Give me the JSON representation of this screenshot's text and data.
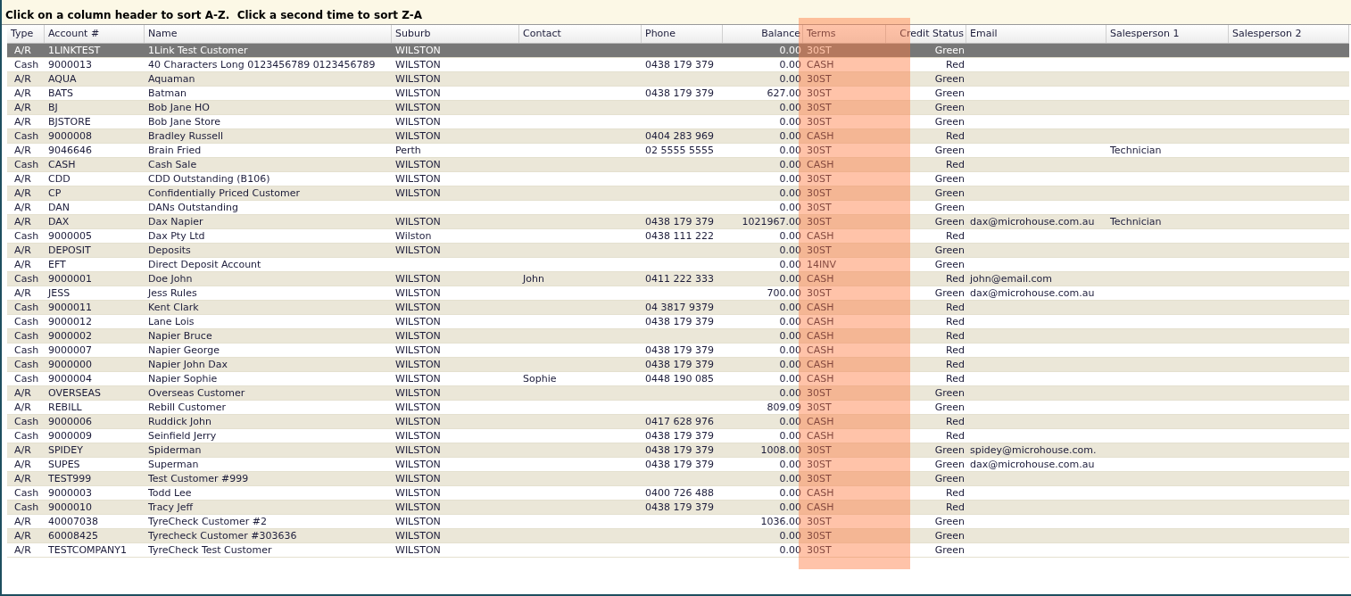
{
  "instructions": "Click on a column header to sort A-Z.  Click a second time to sort Z-A",
  "columns": [
    {
      "label": "Type",
      "highlighted": false
    },
    {
      "label": "Account #",
      "highlighted": false
    },
    {
      "label": "Name",
      "highlighted": false
    },
    {
      "label": "Suburb",
      "highlighted": false
    },
    {
      "label": "Contact",
      "highlighted": false
    },
    {
      "label": "Phone",
      "highlighted": false
    },
    {
      "label": "Balance",
      "highlighted": false
    },
    {
      "label": "Terms",
      "highlighted": true
    },
    {
      "label": "Credit Status",
      "highlighted": false
    },
    {
      "label": "Email",
      "highlighted": false
    },
    {
      "label": "Salesperson 1",
      "highlighted": false
    },
    {
      "label": "Salesperson 2",
      "highlighted": false
    }
  ],
  "rows": [
    {
      "selected": true,
      "type": "A/R",
      "account": "1LINKTEST",
      "name": "1Link Test Customer",
      "suburb": "WILSTON",
      "balance": "0.00",
      "terms": "30ST",
      "credit_status": "Green"
    },
    {
      "selected": false,
      "type": "Cash",
      "account": "9000013",
      "name": "40 Characters Long 0123456789 0123456789",
      "suburb": "WILSTON",
      "phone": "0438 179 379",
      "balance": "0.00",
      "terms": "CASH",
      "credit_status": "Red"
    },
    {
      "selected": false,
      "type": "A/R",
      "account": "AQUA",
      "name": "Aquaman",
      "suburb": "WILSTON",
      "balance": "0.00",
      "terms": "30ST",
      "credit_status": "Green"
    },
    {
      "selected": false,
      "type": "A/R",
      "account": "BATS",
      "name": "Batman",
      "suburb": "WILSTON",
      "phone": "0438 179 379",
      "balance": "627.00",
      "terms": "30ST",
      "credit_status": "Green"
    },
    {
      "selected": false,
      "type": "A/R",
      "account": "BJ",
      "name": "Bob Jane HO",
      "suburb": "WILSTON",
      "balance": "0.00",
      "terms": "30ST",
      "credit_status": "Green"
    },
    {
      "selected": false,
      "type": "A/R",
      "account": "BJSTORE",
      "name": "Bob Jane Store",
      "suburb": "WILSTON",
      "balance": "0.00",
      "terms": "30ST",
      "credit_status": "Green"
    },
    {
      "selected": false,
      "type": "Cash",
      "account": "9000008",
      "name": "Bradley Russell",
      "suburb": "WILSTON",
      "phone": "0404 283 969",
      "balance": "0.00",
      "terms": "CASH",
      "credit_status": "Red"
    },
    {
      "selected": false,
      "type": "A/R",
      "account": "9046646",
      "name": "Brain Fried",
      "suburb": "Perth",
      "phone": "02 5555 5555",
      "balance": "0.00",
      "terms": "30ST",
      "credit_status": "Green",
      "salesperson_1": "Technician"
    },
    {
      "selected": false,
      "type": "Cash",
      "account": "CASH",
      "name": "Cash Sale",
      "suburb": "WILSTON",
      "balance": "0.00",
      "terms": "CASH",
      "credit_status": "Red"
    },
    {
      "selected": false,
      "type": "A/R",
      "account": "CDD",
      "name": "CDD Outstanding (B106)",
      "suburb": "WILSTON",
      "balance": "0.00",
      "terms": "30ST",
      "credit_status": "Green"
    },
    {
      "selected": false,
      "type": "A/R",
      "account": "CP",
      "name": "Confidentially Priced Customer",
      "suburb": "WILSTON",
      "balance": "0.00",
      "terms": "30ST",
      "credit_status": "Green"
    },
    {
      "selected": false,
      "type": "A/R",
      "account": "DAN",
      "name": "DANs Outstanding",
      "balance": "0.00",
      "terms": "30ST",
      "credit_status": "Green"
    },
    {
      "selected": false,
      "type": "A/R",
      "account": "DAX",
      "name": "Dax Napier",
      "suburb": "WILSTON",
      "phone": "0438 179 379",
      "balance": "1021967.00",
      "terms": "30ST",
      "credit_status": "Green",
      "email": "dax@microhouse.com.au",
      "salesperson_1": "Technician"
    },
    {
      "selected": false,
      "type": "Cash",
      "account": "9000005",
      "name": "Dax Pty Ltd",
      "suburb": "Wilston",
      "phone": "0438 111 222",
      "balance": "0.00",
      "terms": "CASH",
      "credit_status": "Red"
    },
    {
      "selected": false,
      "type": "A/R",
      "account": "DEPOSIT",
      "name": "Deposits",
      "suburb": "WILSTON",
      "balance": "0.00",
      "terms": "30ST",
      "credit_status": "Green"
    },
    {
      "selected": false,
      "type": "A/R",
      "account": "EFT",
      "name": "Direct Deposit Account",
      "balance": "0.00",
      "terms": "14INV",
      "credit_status": "Green"
    },
    {
      "selected": false,
      "type": "Cash",
      "account": "9000001",
      "name": "Doe John",
      "suburb": "WILSTON",
      "contact": "John",
      "phone": "0411 222 333",
      "balance": "0.00",
      "terms": "CASH",
      "credit_status": "Red",
      "email": "john@email.com"
    },
    {
      "selected": false,
      "type": "A/R",
      "account": "JESS",
      "name": "Jess Rules",
      "suburb": "WILSTON",
      "balance": "700.00",
      "terms": "30ST",
      "credit_status": "Green",
      "email": "dax@microhouse.com.au"
    },
    {
      "selected": false,
      "type": "Cash",
      "account": "9000011",
      "name": "Kent Clark",
      "suburb": "WILSTON",
      "phone": "04 3817 9379",
      "balance": "0.00",
      "terms": "CASH",
      "credit_status": "Red"
    },
    {
      "selected": false,
      "type": "Cash",
      "account": "9000012",
      "name": "Lane Lois",
      "suburb": "WILSTON",
      "phone": "0438 179 379",
      "balance": "0.00",
      "terms": "CASH",
      "credit_status": "Red"
    },
    {
      "selected": false,
      "type": "Cash",
      "account": "9000002",
      "name": "Napier Bruce",
      "suburb": "WILSTON",
      "balance": "0.00",
      "terms": "CASH",
      "credit_status": "Red"
    },
    {
      "selected": false,
      "type": "Cash",
      "account": "9000007",
      "name": "Napier George",
      "suburb": "WILSTON",
      "phone": "0438 179 379",
      "balance": "0.00",
      "terms": "CASH",
      "credit_status": "Red"
    },
    {
      "selected": false,
      "type": "Cash",
      "account": "9000000",
      "name": "Napier John Dax",
      "suburb": "WILSTON",
      "phone": "0438 179 379",
      "balance": "0.00",
      "terms": "CASH",
      "credit_status": "Red"
    },
    {
      "selected": false,
      "type": "Cash",
      "account": "9000004",
      "name": "Napier Sophie",
      "suburb": "WILSTON",
      "contact": "Sophie",
      "phone": "0448 190 085",
      "balance": "0.00",
      "terms": "CASH",
      "credit_status": "Red"
    },
    {
      "selected": false,
      "type": "A/R",
      "account": "OVERSEAS",
      "name": "Overseas Customer",
      "suburb": "WILSTON",
      "balance": "0.00",
      "terms": "30ST",
      "credit_status": "Green"
    },
    {
      "selected": false,
      "type": "A/R",
      "account": "REBILL",
      "name": "Rebill Customer",
      "suburb": "WILSTON",
      "balance": "809.09",
      "terms": "30ST",
      "credit_status": "Green"
    },
    {
      "selected": false,
      "type": "Cash",
      "account": "9000006",
      "name": "Ruddick John",
      "suburb": "WILSTON",
      "phone": "0417 628 976",
      "balance": "0.00",
      "terms": "CASH",
      "credit_status": "Red"
    },
    {
      "selected": false,
      "type": "Cash",
      "account": "9000009",
      "name": "Seinfield Jerry",
      "suburb": "WILSTON",
      "phone": "0438 179 379",
      "balance": "0.00",
      "terms": "CASH",
      "credit_status": "Red"
    },
    {
      "selected": false,
      "type": "A/R",
      "account": "SPIDEY",
      "name": "Spiderman",
      "suburb": "WILSTON",
      "phone": "0438 179 379",
      "balance": "1008.00",
      "terms": "30ST",
      "credit_status": "Green",
      "email": "spidey@microhouse.com."
    },
    {
      "selected": false,
      "type": "A/R",
      "account": "SUPES",
      "name": "Superman",
      "suburb": "WILSTON",
      "phone": "0438 179 379",
      "balance": "0.00",
      "terms": "30ST",
      "credit_status": "Green",
      "email": "dax@microhouse.com.au"
    },
    {
      "selected": false,
      "type": "A/R",
      "account": "TEST999",
      "name": "Test Customer #999",
      "suburb": "WILSTON",
      "balance": "0.00",
      "terms": "30ST",
      "credit_status": "Green"
    },
    {
      "selected": false,
      "type": "Cash",
      "account": "9000003",
      "name": "Todd Lee",
      "suburb": "WILSTON",
      "phone": "0400 726 488",
      "balance": "0.00",
      "terms": "CASH",
      "credit_status": "Red"
    },
    {
      "selected": false,
      "type": "Cash",
      "account": "9000010",
      "name": "Tracy Jeff",
      "suburb": "WILSTON",
      "phone": "0438 179 379",
      "balance": "0.00",
      "terms": "CASH",
      "credit_status": "Red"
    },
    {
      "selected": false,
      "type": "A/R",
      "account": "40007038",
      "name": "TyreCheck Customer #2",
      "suburb": "WILSTON",
      "balance": "1036.00",
      "terms": "30ST",
      "credit_status": "Green"
    },
    {
      "selected": false,
      "type": "A/R",
      "account": "60008425",
      "name": "Tyrecheck Customer #303636",
      "suburb": "WILSTON",
      "balance": "0.00",
      "terms": "30ST",
      "credit_status": "Green"
    },
    {
      "selected": false,
      "type": "A/R",
      "account": "TESTCOMPANY1",
      "name": "TyreCheck Test Customer",
      "suburb": "WILSTON",
      "balance": "0.00",
      "terms": "30ST",
      "credit_status": "Green"
    }
  ]
}
